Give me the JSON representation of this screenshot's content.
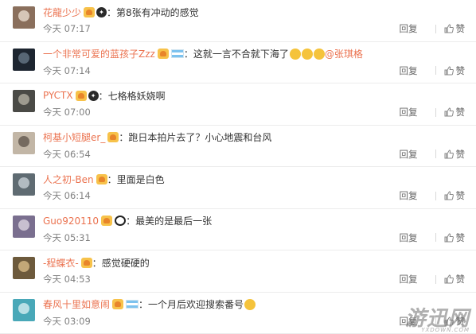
{
  "comments": [
    {
      "name": "花龍少少",
      "text": "第8张有冲动的感觉",
      "time": "今天 07:17",
      "avatar": [
        "#8a6f5c",
        "#efe3d5"
      ],
      "badges": [
        "vip",
        "dark"
      ]
    },
    {
      "name": "一个非常可爱的蓝孩子Zzz",
      "text": "这就一言不合就下海了",
      "mention": "@张琪格",
      "emoji_count": 3,
      "time": "今天 07:14",
      "avatar": [
        "#1d2530",
        "#6b7c8c"
      ],
      "badges": [
        "vip",
        "flag"
      ]
    },
    {
      "name": "PYCTX",
      "text": "七格格妖娆啊",
      "time": "今天 07:00",
      "avatar": [
        "#4a4a46",
        "#b9b6a8"
      ],
      "badges": [
        "vip",
        "dark"
      ]
    },
    {
      "name": "柯基小短腿er_",
      "text": "跑日本拍片去了？小心地震和台风",
      "time": "今天 06:54",
      "avatar": [
        "#c2b6a6",
        "#5b5047"
      ],
      "badges": [
        "vip"
      ]
    },
    {
      "name": "人之初-Ben",
      "text": "里面是白色",
      "time": "今天 06:14",
      "avatar": [
        "#5f6b72",
        "#cdd6dc"
      ],
      "badges": [
        "vip"
      ]
    },
    {
      "name": "Guo920110",
      "text": "最美的是最后一张",
      "time": "今天 05:31",
      "avatar": [
        "#7a6f8f",
        "#e3dbe6"
      ],
      "badges": [
        "vip",
        "panda"
      ]
    },
    {
      "name": "-程蝶衣-",
      "text": "感觉硬硬的",
      "time": "今天 04:53",
      "avatar": [
        "#6d5a3c",
        "#e0c38c"
      ],
      "badges": [
        "vip"
      ]
    },
    {
      "name": "春风十里如意闹",
      "text": "一个月后欢迎搜索番号",
      "emoji_count": 1,
      "time": "今天 03:09",
      "avatar": [
        "#49a8b8",
        "#dff2f4"
      ],
      "badges": [
        "vip",
        "flag"
      ]
    }
  ],
  "reply_label": "回复",
  "like_label": "赞",
  "separator": "：",
  "watermark": "游迅网",
  "watermark_sub": "YXDOWN.COM",
  "colors": {
    "username": "#eb7350",
    "text": "#333333",
    "meta": "#808080"
  }
}
